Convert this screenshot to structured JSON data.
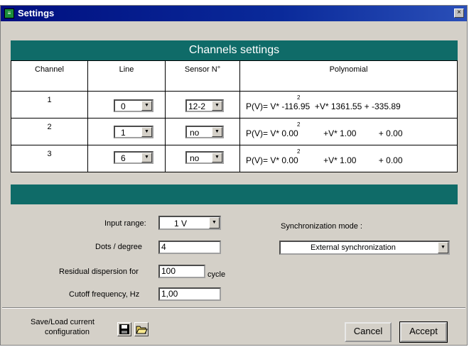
{
  "window": {
    "title": "Settings",
    "close_glyph": "×"
  },
  "channels": {
    "header": "Channels settings",
    "columns": [
      "Channel",
      "Line",
      "Sensor N°",
      "Polynomial"
    ],
    "rows": [
      {
        "channel": "1",
        "line": "0",
        "sensor": "12-2",
        "prefix": "P(V)= V*",
        "exp": "2",
        "a": "-116.95",
        "mid": "+V*",
        "b": "1361.55",
        "plus": "+",
        "c": "-335.89"
      },
      {
        "channel": "2",
        "line": "1",
        "sensor": "no",
        "prefix": "P(V)= V*",
        "exp": "2",
        "a": "0.00",
        "mid": "+V*",
        "b": "1.00",
        "plus": "+",
        "c": "0.00"
      },
      {
        "channel": "3",
        "line": "6",
        "sensor": "no",
        "prefix": "P(V)= V*",
        "exp": "2",
        "a": "0.00",
        "mid": "+V*",
        "b": "1.00",
        "plus": "+",
        "c": "0.00"
      }
    ]
  },
  "params": {
    "input_range_label": "Input range:",
    "input_range_value": "1 V",
    "dots_label": "Dots / degree",
    "dots_value": "4",
    "residual_label": "Residual dispersion for",
    "residual_value": "100",
    "residual_unit": "cycle",
    "cutoff_label": "Cutoff frequency, Hz",
    "cutoff_value": "1,00",
    "sync_label": "Synchronization mode :",
    "sync_value": "External synchronization"
  },
  "footer": {
    "save_load_line1": "Save/Load current",
    "save_load_line2": "configuration",
    "save_icon": "floppy-disk-icon",
    "open_icon": "open-folder-icon",
    "cancel_label": "Cancel",
    "accept_label": "Accept"
  },
  "colors": {
    "title_bar": "#000f80",
    "banner": "#0f6b68",
    "dialog_bg": "#d4d0c8"
  }
}
